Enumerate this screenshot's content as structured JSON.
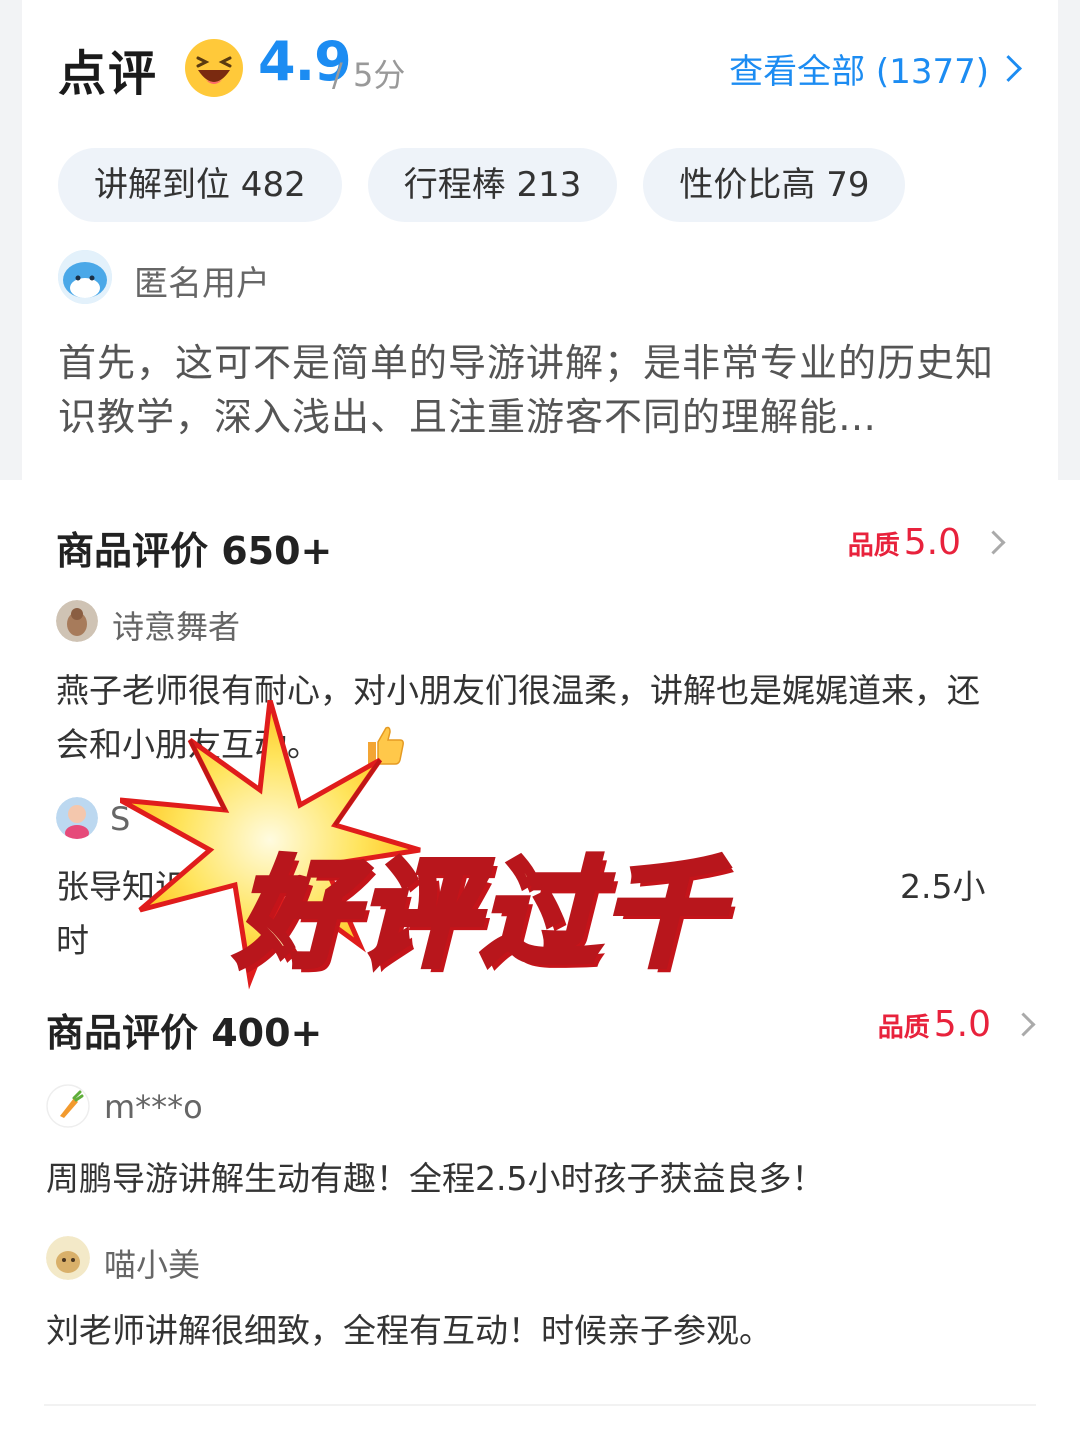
{
  "header": {
    "title": "点评",
    "score": "4.9",
    "score_max": "/ 5分",
    "view_all": "查看全部 (1377)"
  },
  "tags": [
    {
      "label": "讲解到位 482"
    },
    {
      "label": "行程棒 213"
    },
    {
      "label": "性价比高 79"
    }
  ],
  "top_review": {
    "user": "匿名用户",
    "text": "首先，这可不是简单的导游讲解；是非常专业的历史知识教学，深入浅出、且注重游客不同的理解能…"
  },
  "section1": {
    "title": "商品评价 650+",
    "quality_label": "品质",
    "quality_value": "5.0",
    "reviews": [
      {
        "user": "诗意舞者",
        "text": "燕子老师很有耐心，对小朋友们很温柔，讲解也是娓娓道来，还会和小朋友互动。"
      },
      {
        "user": "S",
        "text": "张导知识",
        "text_tail": "2.5小",
        "text_line2": "时"
      }
    ]
  },
  "banner": {
    "text": "好评过千"
  },
  "section2": {
    "title": "商品评价 400+",
    "quality_label": "品质",
    "quality_value": "5.0",
    "reviews": [
      {
        "user": "m***o",
        "text": "周鹏导游讲解生动有趣！全程2.5小时孩子获益良多！"
      },
      {
        "user": "喵小美",
        "text": "刘老师讲解很细致，全程有互动！时候亲子参观。"
      }
    ]
  },
  "colors": {
    "accent": "#1c8cf2",
    "quality": "#e8223c",
    "banner_fill": "#fff4b0",
    "banner_stroke": "#b8161c"
  }
}
